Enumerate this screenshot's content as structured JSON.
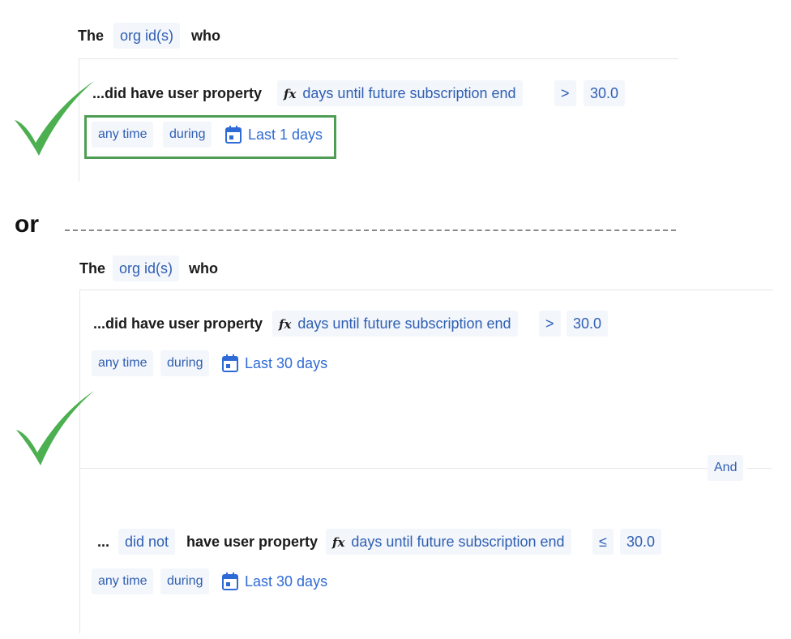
{
  "colors": {
    "accent": "#2f5fb3",
    "check": "#4caf50",
    "highlight": "#4e9d55"
  },
  "top": {
    "the": "The",
    "entity": "org id(s)",
    "who": "who",
    "clause": "...did have user property",
    "fx_icon": "fx",
    "property": "days until future subscription end",
    "operator": ">",
    "value": "30.0",
    "any_time": "any time",
    "during": "during",
    "range": "Last 1 days"
  },
  "or_label": "or",
  "bottom": {
    "the": "The",
    "entity": "org id(s)",
    "who": "who",
    "cond1": {
      "clause": "...did have user property",
      "fx_icon": "fx",
      "property": "days until future subscription end",
      "operator": ">",
      "value": "30.0",
      "any_time": "any time",
      "during": "during",
      "range": "Last 30 days"
    },
    "and_label": "And",
    "cond2": {
      "ellipsis": "...",
      "did_not": "did not",
      "clause": "have user property",
      "fx_icon": "fx",
      "property": "days until future subscription end",
      "operator": "≤",
      "value": "30.0",
      "any_time": "any time",
      "during": "during",
      "range": "Last 30 days"
    }
  }
}
